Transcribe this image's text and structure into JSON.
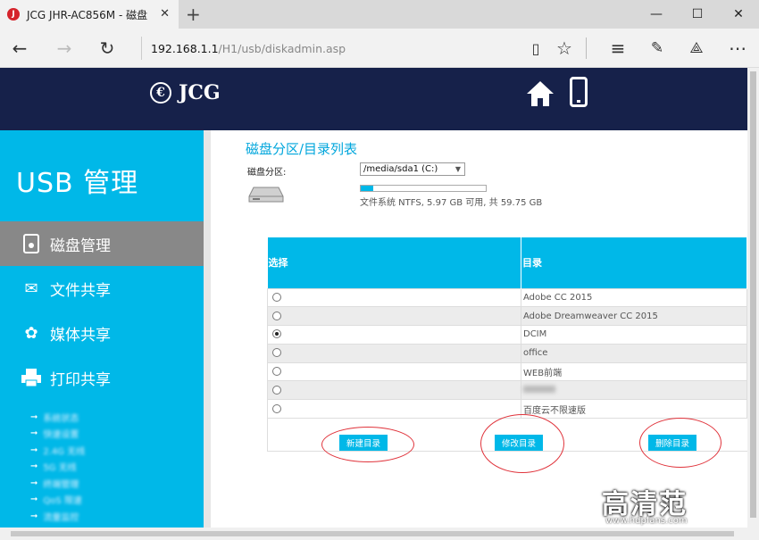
{
  "browser": {
    "tab_title": "JCG JHR-AC856M - 磁盘",
    "tab_favicon_letter": "J",
    "address_host": "192.168.1.1",
    "address_path": "/H1/usb/diskadmin.asp"
  },
  "header": {
    "logo_text": "JCG",
    "logo_mark": "€"
  },
  "sidebar": {
    "title": "USB 管理",
    "items": [
      {
        "label": "磁盘管理",
        "icon": "disk-icon",
        "active": true
      },
      {
        "label": "文件共享",
        "icon": "file-share-icon",
        "active": false
      },
      {
        "label": "媒体共享",
        "icon": "media-share-icon",
        "active": false
      },
      {
        "label": "打印共享",
        "icon": "printer-icon",
        "active": false
      }
    ],
    "sub_items": [
      "系统状态",
      "快速设置",
      "2.4G 无线",
      "5G 无线",
      "终端管理",
      "QoS 限速",
      "流量监控"
    ]
  },
  "content": {
    "title": "磁盘分区/目录列表",
    "disk_label": "磁盘分区:",
    "disk_selected": "/media/sda1 (C:)",
    "disk_info": "文件系统 NTFS, 5.97 GB 可用, 共 59.75 GB",
    "usage_fraction": 0.1,
    "table": {
      "headers": [
        "选择",
        "目录"
      ],
      "rows": [
        {
          "name": "Adobe CC 2015",
          "selected": false,
          "blurred": false
        },
        {
          "name": "Adobe Dreamweaver CC 2015",
          "selected": false,
          "blurred": false
        },
        {
          "name": "DCIM",
          "selected": true,
          "blurred": false
        },
        {
          "name": "office",
          "selected": false,
          "blurred": false
        },
        {
          "name": "WEB前端",
          "selected": false,
          "blurred": false
        },
        {
          "name": "",
          "selected": false,
          "blurred": true
        },
        {
          "name": "百度云不限速版",
          "selected": false,
          "blurred": false
        }
      ]
    },
    "buttons": {
      "new": "新建目录",
      "edit": "修改目录",
      "delete": "删除目录"
    }
  },
  "watermark": {
    "brand": "高清范",
    "url": "www.hdpfans.com"
  },
  "colors": {
    "accent": "#00b8e8",
    "header_bg": "#16214a",
    "highlight_ring": "#e0333b"
  }
}
